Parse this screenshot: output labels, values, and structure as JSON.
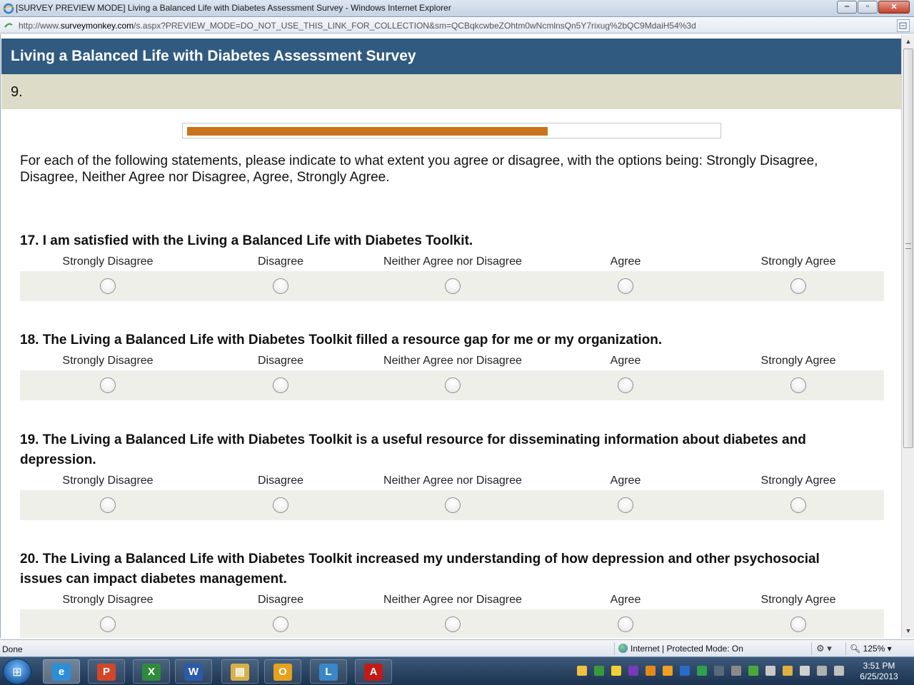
{
  "window": {
    "title": "[SURVEY PREVIEW MODE] Living a Balanced Life with Diabetes Assessment Survey - Windows Internet Explorer",
    "minimize": "‒",
    "maximize": "▫",
    "close": "✕"
  },
  "address": {
    "prefix": "http://www.",
    "domain": "surveymonkey.com",
    "rest": "/s.aspx?PREVIEW_MODE=DO_NOT_USE_THIS_LINK_FOR_COLLECTION&sm=QCBqkcwbeZOhtm0wNcmlnsQn5Y7rixug%2bQC9MdaiH54%3d"
  },
  "survey": {
    "title": "Living a Balanced Life with Diabetes Assessment Survey",
    "page_number": "9.",
    "progress_fraction": 0.68,
    "instructions": "For each of the following statements, please indicate to what extent you agree or disagree, with the options being: Strongly Disagree, Disagree, Neither Agree nor Disagree, Agree, Strongly Agree.",
    "options": [
      "Strongly Disagree",
      "Disagree",
      "Neither Agree nor Disagree",
      "Agree",
      "Strongly Agree"
    ],
    "questions": [
      {
        "text": "17. I am satisfied with the Living a Balanced Life with Diabetes Toolkit."
      },
      {
        "text": "18. The Living a Balanced Life with Diabetes Toolkit filled a resource gap for me or my organization."
      },
      {
        "text": "19. The Living a Balanced Life with Diabetes Toolkit is a useful resource for disseminating information about diabetes and depression."
      },
      {
        "text": "20. The Living a Balanced Life with Diabetes Toolkit increased my understanding of how depression and other psychosocial issues can impact diabetes management."
      }
    ]
  },
  "statusbar": {
    "status": "Done",
    "zone": "Internet | Protected Mode: On",
    "zoom": "125%"
  },
  "taskbar": {
    "apps": [
      {
        "name": "internet-explorer",
        "glyph": "e",
        "color": "#2d8ed8"
      },
      {
        "name": "powerpoint",
        "glyph": "P",
        "color": "#d2472a"
      },
      {
        "name": "excel",
        "glyph": "X",
        "color": "#2f8a3c"
      },
      {
        "name": "word",
        "glyph": "W",
        "color": "#2a5ba8"
      },
      {
        "name": "file-explorer",
        "glyph": "▤",
        "color": "#d8b04a"
      },
      {
        "name": "outlook",
        "glyph": "O",
        "color": "#e6a21e"
      },
      {
        "name": "lync",
        "glyph": "L",
        "color": "#3b86c6"
      },
      {
        "name": "adobe-reader",
        "glyph": "A",
        "color": "#c21b17"
      }
    ],
    "time": "3:51 PM",
    "date": "6/25/2013"
  }
}
